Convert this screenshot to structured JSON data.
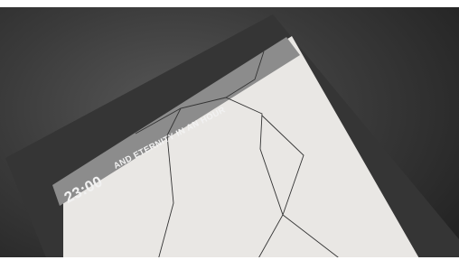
{
  "screen": {
    "time": "23:00",
    "banner_text": "AND ETERNITY IN AN HOUR"
  },
  "colors": {
    "background_center": "#575757",
    "background_edge": "#232323",
    "bezel": "#353535",
    "screen": "#e9e7e4",
    "header_bar": "#8c8c8c",
    "crack_lines": "#333333",
    "text": "#f2f2f2"
  }
}
